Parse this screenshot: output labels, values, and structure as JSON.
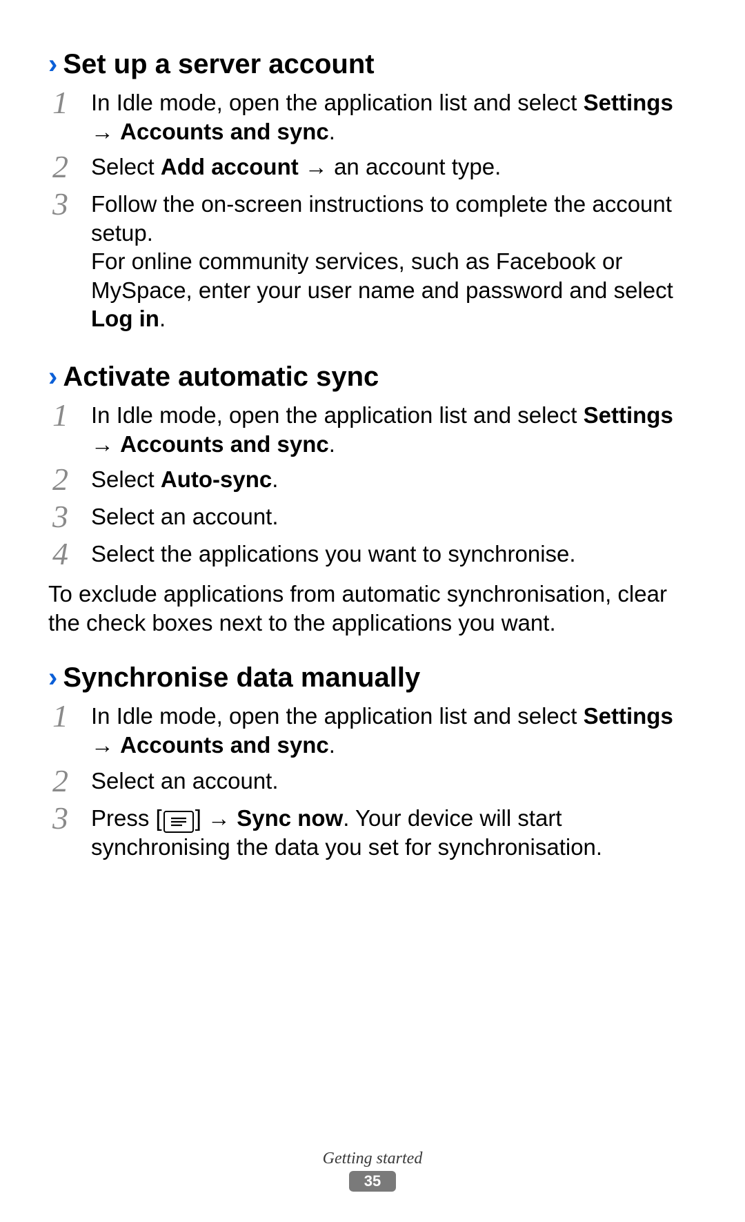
{
  "sections": [
    {
      "heading": "Set up a server account",
      "steps": [
        {
          "num": "1",
          "html_key": "s1_1"
        },
        {
          "num": "2",
          "html_key": "s1_2"
        },
        {
          "num": "3",
          "html_key": "s1_3"
        }
      ]
    },
    {
      "heading": "Activate automatic sync",
      "steps": [
        {
          "num": "1",
          "html_key": "s2_1"
        },
        {
          "num": "2",
          "html_key": "s2_2"
        },
        {
          "num": "3",
          "html_key": "s2_3"
        },
        {
          "num": "4",
          "html_key": "s2_4"
        }
      ],
      "trailing_para_key": "s2_para"
    },
    {
      "heading": "Synchronise data manually",
      "steps": [
        {
          "num": "1",
          "html_key": "s3_1"
        },
        {
          "num": "2",
          "html_key": "s3_2"
        },
        {
          "num": "3",
          "html_key": "s3_3"
        }
      ]
    }
  ],
  "text": {
    "s1_1_a": "In Idle mode, open the application list and select ",
    "s1_1_b": "Settings",
    "s1_1_c": " → ",
    "s1_1_d": "Accounts and sync",
    "s1_1_e": ".",
    "s1_2_a": "Select ",
    "s1_2_b": "Add account",
    "s1_2_c": " → an account type.",
    "s1_3_a": "Follow the on-screen instructions to complete the account setup.",
    "s1_3_b": "For online community services, such as Facebook or MySpace, enter your user name and password and select ",
    "s1_3_c": "Log in",
    "s1_3_d": ".",
    "s2_1_a": "In Idle mode, open the application list and select ",
    "s2_1_b": "Settings",
    "s2_1_c": " → ",
    "s2_1_d": "Accounts and sync",
    "s2_1_e": ".",
    "s2_2_a": "Select ",
    "s2_2_b": "Auto-sync",
    "s2_2_c": ".",
    "s2_3_a": "Select an account.",
    "s2_4_a": "Select the applications you want to synchronise.",
    "s2_para": "To exclude applications from automatic synchronisation, clear the check boxes next to the applications you want.",
    "s3_1_a": "In Idle mode, open the application list and select ",
    "s3_1_b": "Settings",
    "s3_1_c": " → ",
    "s3_1_d": "Accounts and sync",
    "s3_1_e": ".",
    "s3_2_a": "Select an account.",
    "s3_3_a": "Press [",
    "s3_3_b": "] → ",
    "s3_3_c": "Sync now",
    "s3_3_d": ". Your device will start synchronising the data you set for synchronisation."
  },
  "footer": {
    "section_label": "Getting started",
    "page_number": "35"
  }
}
